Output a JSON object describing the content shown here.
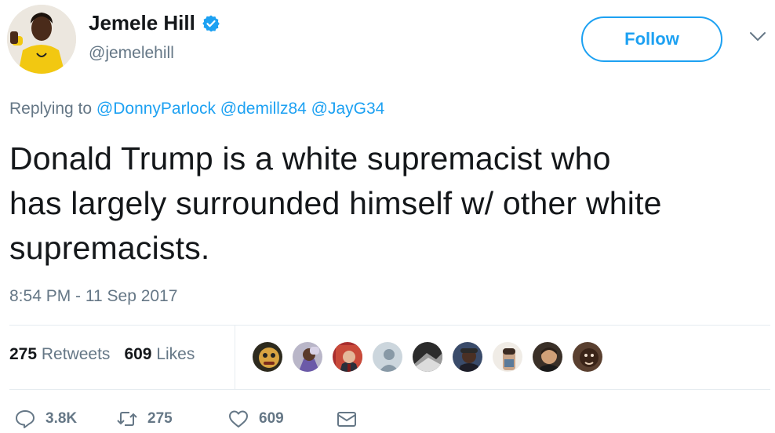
{
  "author": {
    "name": "Jemele Hill",
    "handle": "@jemelehill",
    "verified_icon": "verified-badge-icon"
  },
  "header": {
    "follow_label": "Follow",
    "menu_icon": "chevron-down-icon"
  },
  "reply": {
    "prefix": "Replying to",
    "mentions": [
      "@DonnyParlock",
      "@demillz84",
      "@JayG34"
    ]
  },
  "tweet": {
    "lines": [
      "Donald Trump is a white supremacist who",
      "has largely surrounded himself w/ other white",
      "supremacists."
    ],
    "timestamp": "8:54 PM - 11 Sep 2017"
  },
  "stats": {
    "retweets_count": "275",
    "retweets_label": "Retweets",
    "likes_count": "609",
    "likes_label": "Likes"
  },
  "actions": {
    "reply_count": "3.8K",
    "retweet_count": "275",
    "like_count": "609"
  },
  "colors": {
    "accent": "#1da1f2",
    "muted": "#657786",
    "text": "#14171a"
  }
}
